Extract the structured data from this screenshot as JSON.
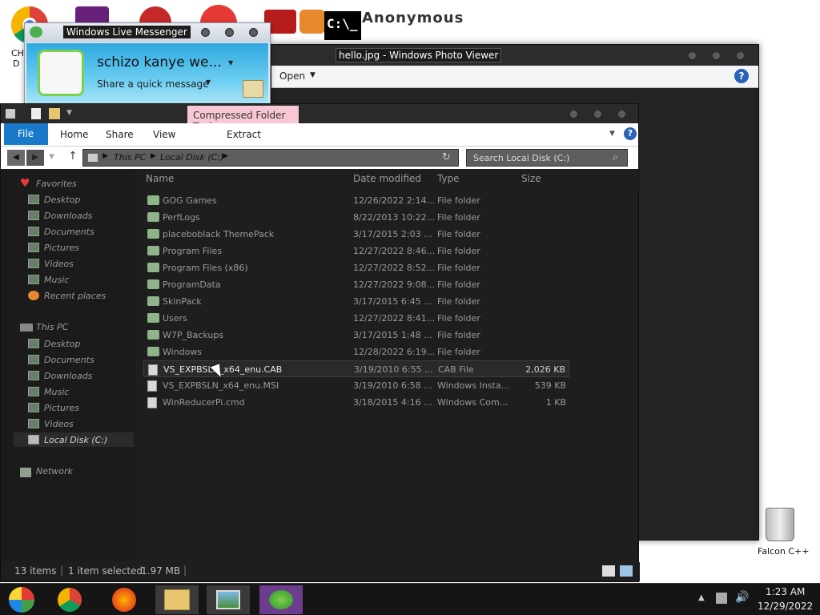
{
  "desktop": {
    "top_label": "Anonymous",
    "recycle_bin_label": "Falcon C++",
    "partial_label_1": "CH",
    "partial_label_2": "D"
  },
  "messenger": {
    "title": "Windows Live Messenger",
    "display_name": "schizo kanye we...",
    "status_prompt": "Share a quick message"
  },
  "photo_viewer": {
    "title": "hello.jpg - Windows Photo Viewer",
    "menu_open": "Open",
    "help_icon": "help-icon"
  },
  "explorer": {
    "contextual_tab": "Compressed Folder Tools",
    "tabs": [
      "File",
      "Home",
      "Share",
      "View",
      "Extract"
    ],
    "breadcrumb": [
      "This PC",
      "Local Disk (C:)"
    ],
    "search_placeholder": "Search Local Disk (C:)",
    "columns": [
      "Name",
      "Date modified",
      "Type",
      "Size"
    ],
    "nav": {
      "favorites": "Favorites",
      "favorites_items": [
        "Desktop",
        "Downloads",
        "Documents",
        "Pictures",
        "Videos",
        "Music",
        "Recent places"
      ],
      "this_pc": "This PC",
      "this_pc_items": [
        "Desktop",
        "Documents",
        "Downloads",
        "Music",
        "Pictures",
        "Videos",
        "Local Disk (C:)"
      ],
      "network": "Network"
    },
    "files": [
      {
        "name": "GOG Games",
        "date": "12/26/2022 2:14...",
        "type": "File folder",
        "size": ""
      },
      {
        "name": "PerfLogs",
        "date": "8/22/2013 10:22...",
        "type": "File folder",
        "size": ""
      },
      {
        "name": "placeboblack ThemePack",
        "date": "3/17/2015 2:03 ...",
        "type": "File folder",
        "size": ""
      },
      {
        "name": "Program Files",
        "date": "12/27/2022 8:46...",
        "type": "File folder",
        "size": ""
      },
      {
        "name": "Program Files (x86)",
        "date": "12/27/2022 8:52...",
        "type": "File folder",
        "size": ""
      },
      {
        "name": "ProgramData",
        "date": "12/27/2022 9:08...",
        "type": "File folder",
        "size": ""
      },
      {
        "name": "SkinPack",
        "date": "3/17/2015 6:45 ...",
        "type": "File folder",
        "size": ""
      },
      {
        "name": "Users",
        "date": "12/27/2022 8:41...",
        "type": "File folder",
        "size": ""
      },
      {
        "name": "W7P_Backups",
        "date": "3/17/2015 1:48 ...",
        "type": "File folder",
        "size": ""
      },
      {
        "name": "Windows",
        "date": "12/28/2022 6:19...",
        "type": "File folder",
        "size": ""
      },
      {
        "name": "VS_EXPBSLN_x64_enu.CAB",
        "date": "3/19/2010 6:55 ...",
        "type": "CAB File",
        "size": "2,026 KB"
      },
      {
        "name": "VS_EXPBSLN_x64_enu.MSI",
        "date": "3/19/2010 6:58 ...",
        "type": "Windows Insta...",
        "size": "539 KB"
      },
      {
        "name": "WinReducerPi.cmd",
        "date": "3/18/2015 4:16 ...",
        "type": "Windows Com...",
        "size": "1 KB"
      }
    ],
    "status": {
      "items": "13 items",
      "selected": "1 item selected",
      "size": "1.97 MB"
    }
  },
  "taskbar": {
    "time": "1:23 AM",
    "date": "12/29/2022"
  }
}
